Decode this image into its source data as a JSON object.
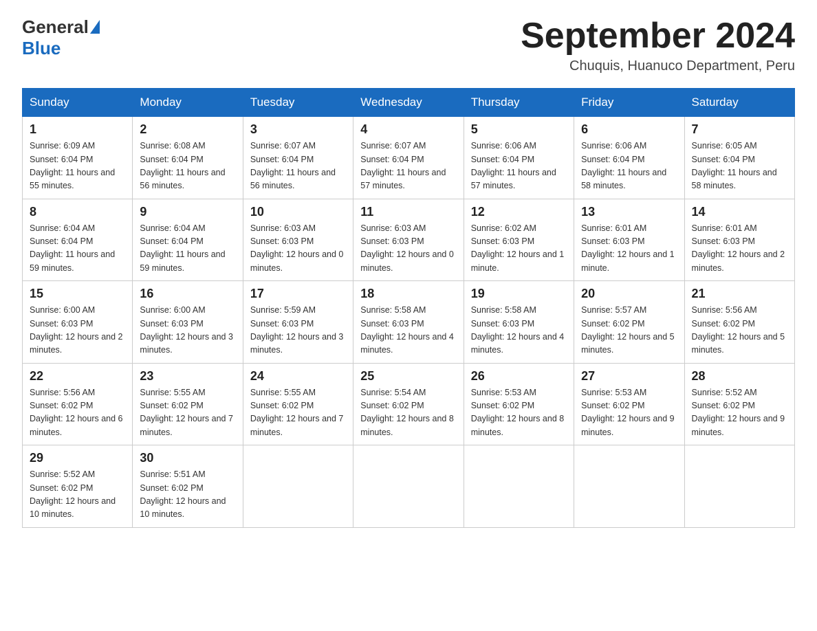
{
  "header": {
    "logo_general": "General",
    "logo_blue": "Blue",
    "month_year": "September 2024",
    "location": "Chuquis, Huanuco Department, Peru"
  },
  "days_of_week": [
    "Sunday",
    "Monday",
    "Tuesday",
    "Wednesday",
    "Thursday",
    "Friday",
    "Saturday"
  ],
  "weeks": [
    [
      {
        "day": "1",
        "sunrise": "6:09 AM",
        "sunset": "6:04 PM",
        "daylight": "11 hours and 55 minutes."
      },
      {
        "day": "2",
        "sunrise": "6:08 AM",
        "sunset": "6:04 PM",
        "daylight": "11 hours and 56 minutes."
      },
      {
        "day": "3",
        "sunrise": "6:07 AM",
        "sunset": "6:04 PM",
        "daylight": "11 hours and 56 minutes."
      },
      {
        "day": "4",
        "sunrise": "6:07 AM",
        "sunset": "6:04 PM",
        "daylight": "11 hours and 57 minutes."
      },
      {
        "day": "5",
        "sunrise": "6:06 AM",
        "sunset": "6:04 PM",
        "daylight": "11 hours and 57 minutes."
      },
      {
        "day": "6",
        "sunrise": "6:06 AM",
        "sunset": "6:04 PM",
        "daylight": "11 hours and 58 minutes."
      },
      {
        "day": "7",
        "sunrise": "6:05 AM",
        "sunset": "6:04 PM",
        "daylight": "11 hours and 58 minutes."
      }
    ],
    [
      {
        "day": "8",
        "sunrise": "6:04 AM",
        "sunset": "6:04 PM",
        "daylight": "11 hours and 59 minutes."
      },
      {
        "day": "9",
        "sunrise": "6:04 AM",
        "sunset": "6:04 PM",
        "daylight": "11 hours and 59 minutes."
      },
      {
        "day": "10",
        "sunrise": "6:03 AM",
        "sunset": "6:03 PM",
        "daylight": "12 hours and 0 minutes."
      },
      {
        "day": "11",
        "sunrise": "6:03 AM",
        "sunset": "6:03 PM",
        "daylight": "12 hours and 0 minutes."
      },
      {
        "day": "12",
        "sunrise": "6:02 AM",
        "sunset": "6:03 PM",
        "daylight": "12 hours and 1 minute."
      },
      {
        "day": "13",
        "sunrise": "6:01 AM",
        "sunset": "6:03 PM",
        "daylight": "12 hours and 1 minute."
      },
      {
        "day": "14",
        "sunrise": "6:01 AM",
        "sunset": "6:03 PM",
        "daylight": "12 hours and 2 minutes."
      }
    ],
    [
      {
        "day": "15",
        "sunrise": "6:00 AM",
        "sunset": "6:03 PM",
        "daylight": "12 hours and 2 minutes."
      },
      {
        "day": "16",
        "sunrise": "6:00 AM",
        "sunset": "6:03 PM",
        "daylight": "12 hours and 3 minutes."
      },
      {
        "day": "17",
        "sunrise": "5:59 AM",
        "sunset": "6:03 PM",
        "daylight": "12 hours and 3 minutes."
      },
      {
        "day": "18",
        "sunrise": "5:58 AM",
        "sunset": "6:03 PM",
        "daylight": "12 hours and 4 minutes."
      },
      {
        "day": "19",
        "sunrise": "5:58 AM",
        "sunset": "6:03 PM",
        "daylight": "12 hours and 4 minutes."
      },
      {
        "day": "20",
        "sunrise": "5:57 AM",
        "sunset": "6:02 PM",
        "daylight": "12 hours and 5 minutes."
      },
      {
        "day": "21",
        "sunrise": "5:56 AM",
        "sunset": "6:02 PM",
        "daylight": "12 hours and 5 minutes."
      }
    ],
    [
      {
        "day": "22",
        "sunrise": "5:56 AM",
        "sunset": "6:02 PM",
        "daylight": "12 hours and 6 minutes."
      },
      {
        "day": "23",
        "sunrise": "5:55 AM",
        "sunset": "6:02 PM",
        "daylight": "12 hours and 7 minutes."
      },
      {
        "day": "24",
        "sunrise": "5:55 AM",
        "sunset": "6:02 PM",
        "daylight": "12 hours and 7 minutes."
      },
      {
        "day": "25",
        "sunrise": "5:54 AM",
        "sunset": "6:02 PM",
        "daylight": "12 hours and 8 minutes."
      },
      {
        "day": "26",
        "sunrise": "5:53 AM",
        "sunset": "6:02 PM",
        "daylight": "12 hours and 8 minutes."
      },
      {
        "day": "27",
        "sunrise": "5:53 AM",
        "sunset": "6:02 PM",
        "daylight": "12 hours and 9 minutes."
      },
      {
        "day": "28",
        "sunrise": "5:52 AM",
        "sunset": "6:02 PM",
        "daylight": "12 hours and 9 minutes."
      }
    ],
    [
      {
        "day": "29",
        "sunrise": "5:52 AM",
        "sunset": "6:02 PM",
        "daylight": "12 hours and 10 minutes."
      },
      {
        "day": "30",
        "sunrise": "5:51 AM",
        "sunset": "6:02 PM",
        "daylight": "12 hours and 10 minutes."
      },
      null,
      null,
      null,
      null,
      null
    ]
  ],
  "labels": {
    "sunrise": "Sunrise:",
    "sunset": "Sunset:",
    "daylight": "Daylight:"
  }
}
